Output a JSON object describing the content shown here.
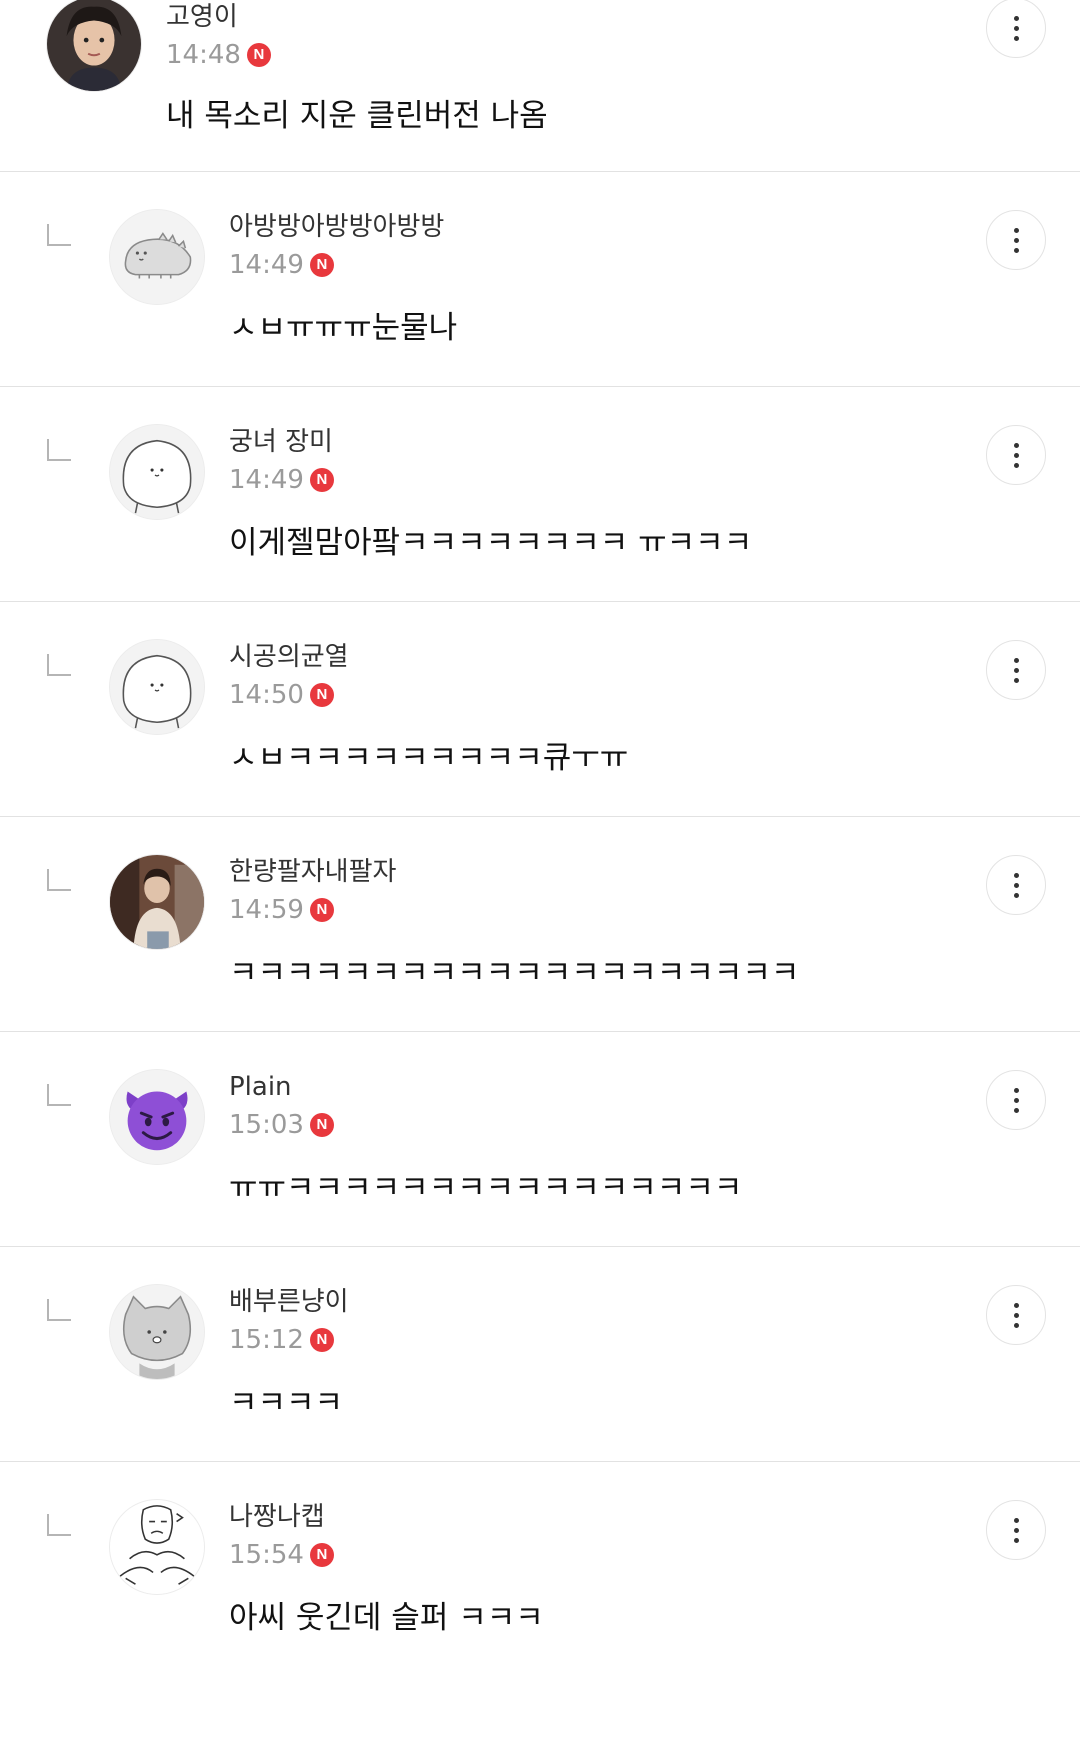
{
  "new_badge": "N",
  "colors": {
    "new_badge": "#e8383d",
    "divider": "#e2e2e2",
    "time": "#9a9a9a"
  },
  "comments": [
    {
      "author": "고영이",
      "time": "14:48",
      "text": "내 목소리 지운 클린버전 나옴",
      "avatar": "child-photo"
    },
    {
      "author": "아방방아방방아방방",
      "time": "14:49",
      "text": "ㅅㅂㅠㅠㅠ눈물나",
      "avatar": "dinosaur-doodle"
    },
    {
      "author": "궁녀 장미",
      "time": "14:49",
      "text": "이게젤맘아팤ㅋㅋㅋㅋㅋㅋㅋㅋ ㅠㅋㅋㅋ",
      "avatar": "default-blob"
    },
    {
      "author": "시공의균열",
      "time": "14:50",
      "text": "ㅅㅂㅋㅋㅋㅋㅋㅋㅋㅋㅋ큐ㅜㅠ",
      "avatar": "default-blob"
    },
    {
      "author": "한량팔자내팔자",
      "time": "14:59",
      "text": "ㅋㅋㅋㅋㅋㅋㅋㅋㅋㅋㅋㅋㅋㅋㅋㅋㅋㅋㅋㅋ",
      "avatar": "person-photo"
    },
    {
      "author": "Plain",
      "time": "15:03",
      "text": "ㅠㅠㅋㅋㅋㅋㅋㅋㅋㅋㅋㅋㅋㅋㅋㅋㅋㅋ",
      "avatar": "devil-emoji"
    },
    {
      "author": "배부른냥이",
      "time": "15:12",
      "text": "ㅋㅋㅋㅋ",
      "avatar": "cat-doodle"
    },
    {
      "author": "나짱나캡",
      "time": "15:54",
      "text": "아씨 웃긴데 슬퍼 ㅋㅋㅋ",
      "avatar": "meme-sketch"
    }
  ]
}
